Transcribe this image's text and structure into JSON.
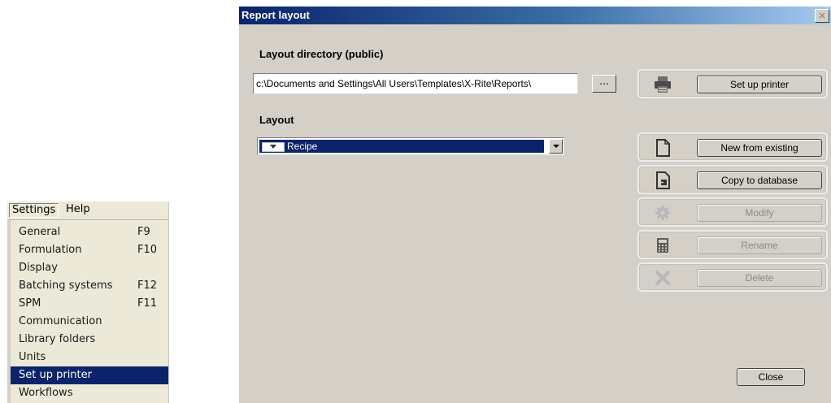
{
  "menu": {
    "bar": {
      "settings": "Settings",
      "help": "Help"
    },
    "items": [
      {
        "label": "General",
        "shortcut": "F9"
      },
      {
        "label": "Formulation",
        "shortcut": "F10"
      },
      {
        "label": "Display",
        "shortcut": ""
      },
      {
        "label": "Batching systems",
        "shortcut": "F12"
      },
      {
        "label": "SPM",
        "shortcut": "F11"
      },
      {
        "label": "Communication",
        "shortcut": ""
      },
      {
        "label": "Library folders",
        "shortcut": ""
      },
      {
        "label": "Units",
        "shortcut": ""
      },
      {
        "label": "Set up printer",
        "shortcut": "",
        "highlighted": true
      },
      {
        "label": "Workflows",
        "shortcut": ""
      }
    ]
  },
  "dialog": {
    "title": "Report layout",
    "close_glyph": "×",
    "directory_label": "Layout directory (public)",
    "directory_value": "c:\\Documents and Settings\\All Users\\Templates\\X-Rite\\Reports\\",
    "browse_label": "...",
    "layout_label": "Layout",
    "layout_selected": "Recipe",
    "actions": [
      {
        "label": "Set up printer",
        "icon": "printer-icon",
        "enabled": true
      },
      {
        "label": "New from existing",
        "icon": "new-document-icon",
        "enabled": true
      },
      {
        "label": "Copy to database",
        "icon": "copy-to-database-icon",
        "enabled": true
      },
      {
        "label": "Modify",
        "icon": "gear-icon",
        "enabled": false
      },
      {
        "label": "Rename",
        "icon": "calculator-icon",
        "enabled": false
      },
      {
        "label": "Delete",
        "icon": "delete-x-icon",
        "enabled": false
      }
    ],
    "close_label": "Close"
  }
}
